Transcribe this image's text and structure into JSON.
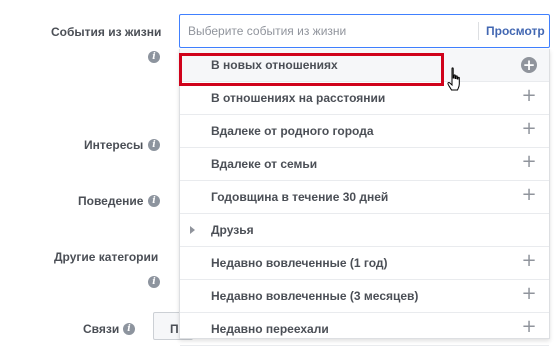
{
  "form": {
    "life_events_label": "События из жизни",
    "interests_label": "Интересы",
    "behavior_label": "Поведение",
    "other_categories_label": "Другие категории",
    "connections_label": "Связи",
    "connections_button_label": "П"
  },
  "search": {
    "placeholder": "Выберите события из жизни",
    "browse_label": "Просмотр"
  },
  "dropdown": {
    "items": [
      {
        "label": "В новых отношениях",
        "icon": "plus-circle-icon",
        "hovered": true
      },
      {
        "label": "В отношениях на расстоянии",
        "icon": "plus-icon"
      },
      {
        "label": "Вдалеке от родного города",
        "icon": "plus-icon"
      },
      {
        "label": "Вдалеке от семьи",
        "icon": "plus-icon"
      },
      {
        "label": "Годовщина в течение 30 дней",
        "icon": "plus-icon"
      },
      {
        "label": "Друзья",
        "icon": "caret-right-icon",
        "expandable": true
      },
      {
        "label": "Недавно вовлеченные (1 год)",
        "icon": "plus-icon"
      },
      {
        "label": "Недавно вовлеченные (3 месяцев)",
        "icon": "plus-icon"
      },
      {
        "label": "Недавно переехали",
        "icon": "plus-icon"
      }
    ]
  },
  "colors": {
    "accent": "#4267b2",
    "focus_border": "#4080ff",
    "highlight": "#d0021b"
  }
}
